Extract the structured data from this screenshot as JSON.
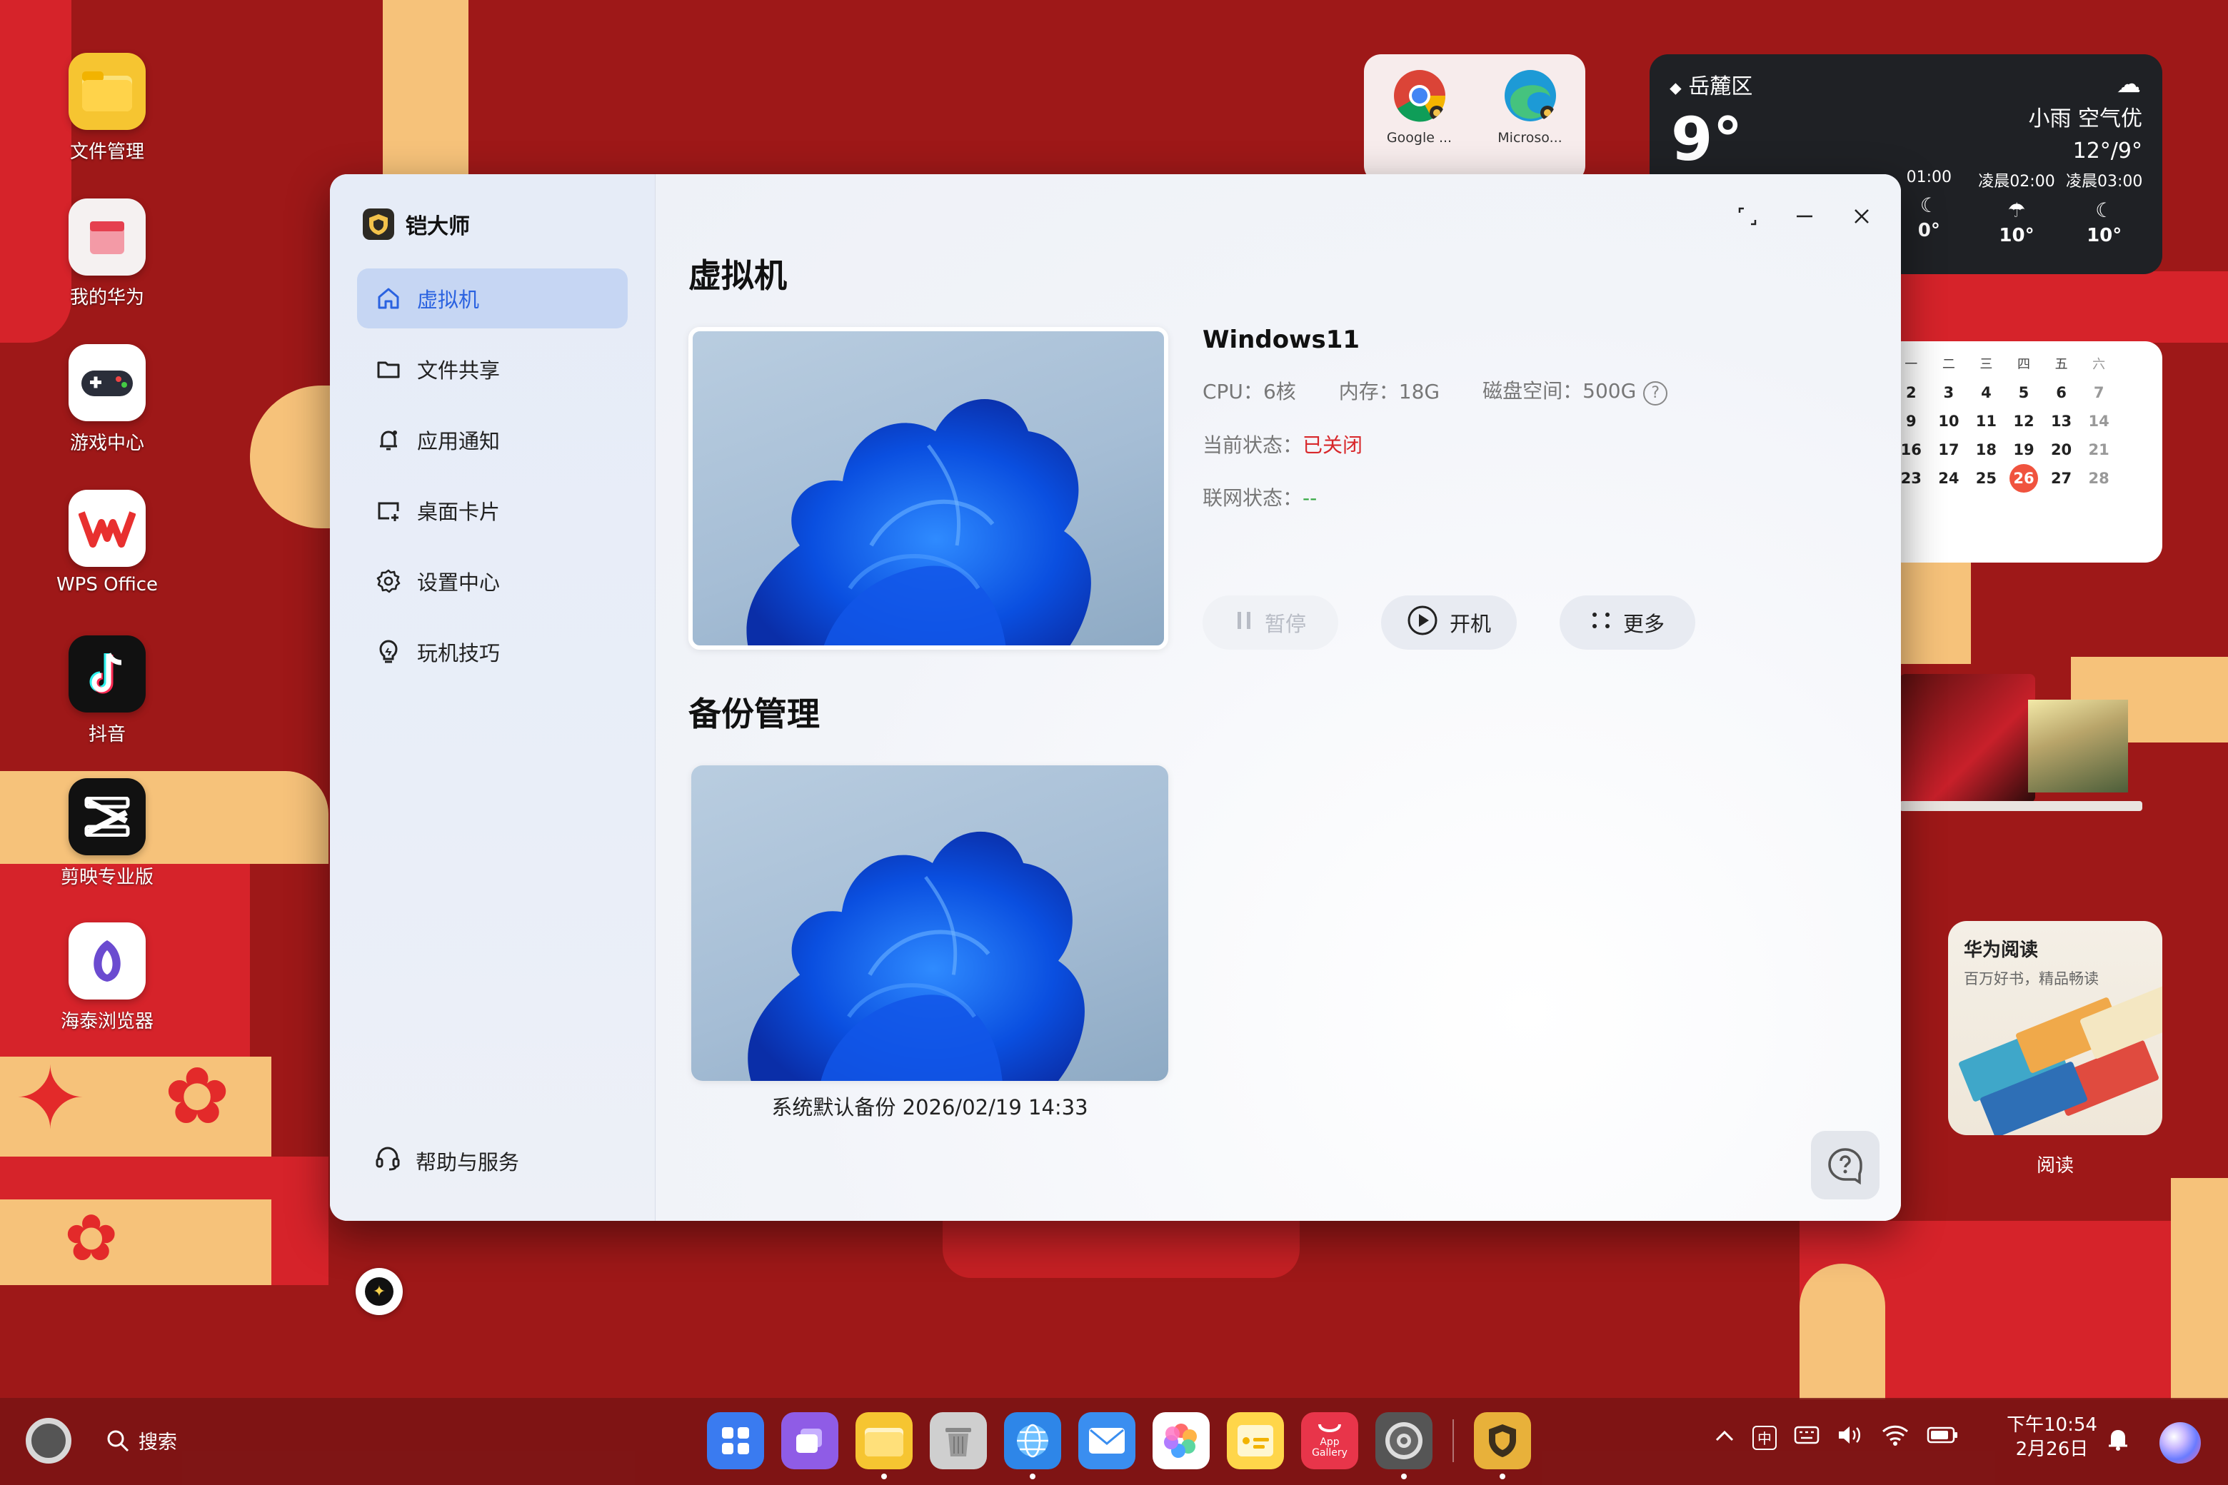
{
  "desktop": {
    "icons": [
      {
        "label": "文件管理",
        "icon": "folder-icon",
        "color": "#f6c531"
      },
      {
        "label": "我的华为",
        "icon": "huawei-box-icon",
        "color": "#f5f1f1"
      },
      {
        "label": "游戏中心",
        "icon": "gamepad-icon",
        "color": "#ffffff"
      },
      {
        "label": "WPS Office",
        "icon": "wps-icon",
        "color": "#ffffff"
      },
      {
        "label": "抖音",
        "icon": "douyin-icon",
        "color": "#111111"
      },
      {
        "label": "剪映专业版",
        "icon": "capcut-icon",
        "color": "#111111"
      },
      {
        "label": "海泰浏览器",
        "icon": "browser-icon",
        "color": "#ffffff"
      }
    ]
  },
  "browser_widget": {
    "items": [
      {
        "label": "Google ...",
        "icon": "chrome-icon"
      },
      {
        "label": "Microso...",
        "icon": "edge-icon"
      }
    ]
  },
  "weather": {
    "location": "岳麓区",
    "temp": "9°",
    "condition": "小雨  空气优",
    "range": "12°/9°",
    "hours": [
      {
        "time": "01:00",
        "temp": "0°"
      },
      {
        "time": "凌晨02:00",
        "temp": "10°"
      },
      {
        "time": "凌晨03:00",
        "temp": "10°"
      }
    ]
  },
  "calendar": {
    "weekdays": [
      "一",
      "二",
      "三",
      "四",
      "五",
      "六"
    ],
    "rows": [
      [
        "2",
        "3",
        "4",
        "5",
        "6",
        "7"
      ],
      [
        "9",
        "10",
        "11",
        "12",
        "13",
        "14"
      ],
      [
        "16",
        "17",
        "18",
        "19",
        "20",
        "21"
      ],
      [
        "23",
        "24",
        "25",
        "26",
        "27",
        "28"
      ]
    ],
    "today": "26"
  },
  "reading": {
    "title": "华为阅读",
    "subtitle": "百万好书，精品畅读",
    "label": "阅读"
  },
  "app": {
    "brand": "铠大师",
    "nav": [
      {
        "label": "虚拟机",
        "icon": "home-icon",
        "active": true
      },
      {
        "label": "文件共享",
        "icon": "folder-outline-icon",
        "active": false
      },
      {
        "label": "应用通知",
        "icon": "bell-icon",
        "active": false
      },
      {
        "label": "桌面卡片",
        "icon": "card-icon",
        "active": false
      },
      {
        "label": "设置中心",
        "icon": "gear-icon",
        "active": false
      },
      {
        "label": "玩机技巧",
        "icon": "bulb-icon",
        "active": false
      }
    ],
    "help": "帮助与服务",
    "vm_section_title": "虚拟机",
    "vm": {
      "name": "Windows11",
      "cpu_label": "CPU：",
      "cpu": "6核",
      "mem_label": "内存：",
      "mem": "18G",
      "disk_label": "磁盘空间：",
      "disk": "500G",
      "status_label": "当前状态：",
      "status": "已关闭",
      "net_label": "联网状态：",
      "net": "--"
    },
    "actions": {
      "pause": "暂停",
      "start": "开机",
      "more": "更多"
    },
    "backup_section_title": "备份管理",
    "backup_caption": "系统默认备份 2026/02/19 14:33"
  },
  "taskbar": {
    "search": "搜索",
    "ime": "中",
    "clock_time": "下午10:54",
    "clock_date": "2月26日",
    "apps": [
      {
        "icon": "grid-apps-icon",
        "color": "#3a7bf0",
        "running": false
      },
      {
        "icon": "multiwindow-icon",
        "color": "#8f5ce6",
        "running": false
      },
      {
        "icon": "files-icon",
        "color": "#f6c531",
        "running": true
      },
      {
        "icon": "trash-icon",
        "color": "#cfcfcf",
        "running": false
      },
      {
        "icon": "browser-globe-icon",
        "color": "#2e86e8",
        "running": true
      },
      {
        "icon": "mail-icon",
        "color": "#3a8ef0",
        "running": false
      },
      {
        "icon": "gallery-icon",
        "color": "#ffffff",
        "running": false
      },
      {
        "icon": "notes-icon",
        "color": "#ffd64a",
        "running": false
      },
      {
        "icon": "app-gallery-icon",
        "color": "#e8354a",
        "running": false,
        "text": "App Gallery"
      },
      {
        "icon": "settings-icon",
        "color": "#555555",
        "running": true
      },
      {
        "icon": "kaidashi-icon",
        "color": "#e8b13a",
        "running": true
      }
    ]
  }
}
